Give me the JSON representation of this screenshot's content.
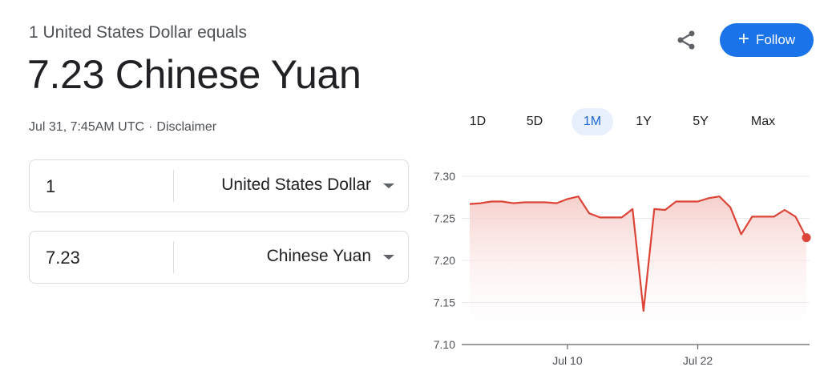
{
  "header": {
    "equals_text": "1 United States Dollar equals",
    "result_text": "7.23 Chinese Yuan",
    "timestamp": "Jul 31, 7:45AM UTC",
    "separator": "·",
    "disclaimer": "Disclaimer",
    "follow_label": "Follow",
    "follow_plus": "+"
  },
  "converter": {
    "from_amount": "1",
    "from_currency": "United States Dollar",
    "to_amount": "7.23",
    "to_currency": "Chinese Yuan"
  },
  "ranges": [
    "1D",
    "5D",
    "1M",
    "1Y",
    "5Y",
    "Max"
  ],
  "active_range": "1M",
  "colors": {
    "accent": "#1a73e8",
    "line": "#db4437",
    "fill_top": "#f4c7c3"
  },
  "chart_data": {
    "type": "area",
    "x": [
      "Jul 1",
      "Jul 2",
      "Jul 3",
      "Jul 4",
      "Jul 5",
      "Jul 6",
      "Jul 7",
      "Jul 8",
      "Jul 9",
      "Jul 10",
      "Jul 11",
      "Jul 12",
      "Jul 13",
      "Jul 14",
      "Jul 15",
      "Jul 16",
      "Jul 17",
      "Jul 18",
      "Jul 19",
      "Jul 20",
      "Jul 21",
      "Jul 22",
      "Jul 23",
      "Jul 24",
      "Jul 25",
      "Jul 26",
      "Jul 27",
      "Jul 28",
      "Jul 29",
      "Jul 30",
      "Jul 31"
    ],
    "values": [
      7.267,
      7.268,
      7.27,
      7.27,
      7.268,
      7.269,
      7.269,
      7.269,
      7.268,
      7.273,
      7.276,
      7.256,
      7.251,
      7.251,
      7.251,
      7.261,
      7.14,
      7.261,
      7.26,
      7.27,
      7.27,
      7.27,
      7.274,
      7.276,
      7.263,
      7.231,
      7.252,
      7.252,
      7.252,
      7.26,
      7.252,
      7.227
    ],
    "yticks": [
      "7.30",
      "7.25",
      "7.20",
      "7.15",
      "7.10"
    ],
    "ylim": [
      7.1,
      7.3
    ],
    "xtick_labels": [
      "Jul 10",
      "Jul 22"
    ],
    "xlabel": "",
    "ylabel": "",
    "grid": true
  }
}
